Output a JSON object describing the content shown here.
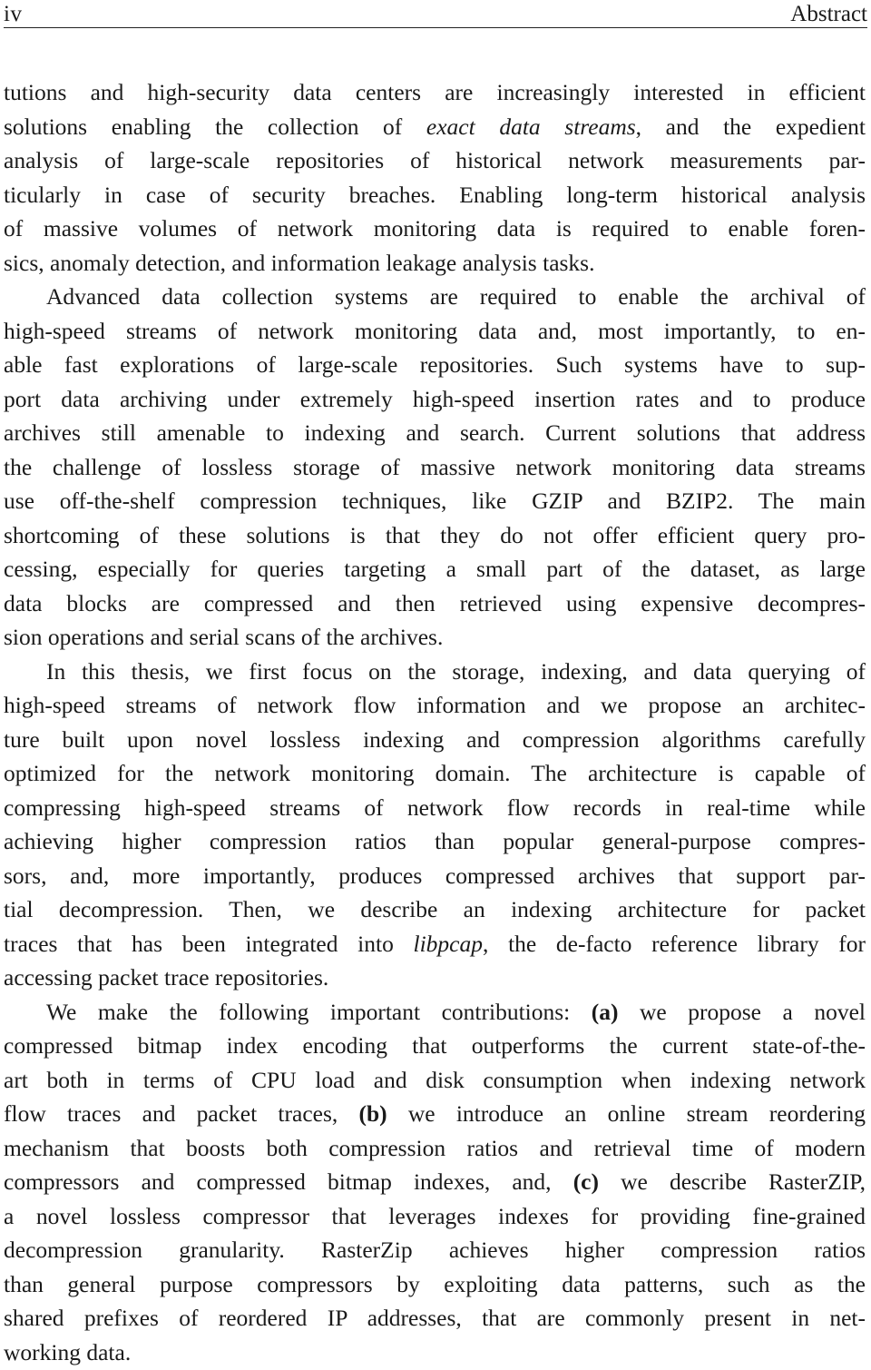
{
  "header": {
    "page_number": "iv",
    "section_title": "Abstract"
  },
  "paragraphs": [
    {
      "id": "p1",
      "indent": false,
      "lines": [
        [
          {
            "t": "tutions and high-security data centers are increasingly interested in efficient"
          }
        ],
        [
          {
            "t": "solutions enabling the collection of "
          },
          {
            "t": "exact data streams",
            "s": "i"
          },
          {
            "t": ", and the expedient"
          }
        ],
        [
          {
            "t": "analysis of large-scale repositories of historical network measurements par-"
          }
        ],
        [
          {
            "t": "ticularly in case of security breaches. Enabling long-term historical analysis"
          }
        ],
        [
          {
            "t": "of massive volumes of network monitoring data is required to enable foren-"
          }
        ],
        [
          {
            "t": "sics, anomaly detection, and information leakage analysis tasks."
          }
        ]
      ]
    },
    {
      "id": "p2",
      "indent": true,
      "lines": [
        [
          {
            "t": "Advanced data collection systems are required to enable the archival of"
          }
        ],
        [
          {
            "t": "high-speed streams of network monitoring data and, most importantly, to en-"
          }
        ],
        [
          {
            "t": "able fast explorations of large-scale repositories. Such systems have to sup-"
          }
        ],
        [
          {
            "t": "port data archiving under extremely high-speed insertion rates and to produce"
          }
        ],
        [
          {
            "t": "archives still amenable to indexing and search. Current solutions that address"
          }
        ],
        [
          {
            "t": "the challenge of lossless storage of massive network monitoring data streams"
          }
        ],
        [
          {
            "t": "use off-the-shelf compression techniques, like GZIP and BZIP2. The main"
          }
        ],
        [
          {
            "t": "shortcoming of these solutions is that they do not offer efficient query pro-"
          }
        ],
        [
          {
            "t": "cessing, especially for queries targeting a small part of the dataset, as large"
          }
        ],
        [
          {
            "t": "data blocks are compressed and then retrieved using expensive decompres-"
          }
        ],
        [
          {
            "t": "sion operations and serial scans of the archives."
          }
        ]
      ]
    },
    {
      "id": "p3",
      "indent": true,
      "lines": [
        [
          {
            "t": "In this thesis, we first focus on the storage, indexing, and data querying of"
          }
        ],
        [
          {
            "t": "high-speed streams of network flow information and we propose an architec-"
          }
        ],
        [
          {
            "t": "ture built upon novel lossless indexing and compression algorithms carefully"
          }
        ],
        [
          {
            "t": "optimized for the network monitoring domain. The architecture is capable of"
          }
        ],
        [
          {
            "t": "compressing high-speed streams of network flow records in real-time while"
          }
        ],
        [
          {
            "t": "achieving higher compression ratios than popular general-purpose compres-"
          }
        ],
        [
          {
            "t": "sors, and, more importantly, produces compressed archives that support par-"
          }
        ],
        [
          {
            "t": "tial decompression. Then, we describe an indexing architecture for packet"
          }
        ],
        [
          {
            "t": "traces that has been integrated into "
          },
          {
            "t": "libpcap",
            "s": "i"
          },
          {
            "t": ", the de-facto reference library for"
          }
        ],
        [
          {
            "t": "accessing packet trace repositories."
          }
        ]
      ]
    },
    {
      "id": "p4",
      "indent": true,
      "lines": [
        [
          {
            "t": "We make the following important contributions: "
          },
          {
            "t": "(a)",
            "s": "b"
          },
          {
            "t": " we propose a novel"
          }
        ],
        [
          {
            "t": "compressed bitmap index encoding that outperforms the current state-of-the-"
          }
        ],
        [
          {
            "t": "art both in terms of CPU load and disk consumption when indexing network"
          }
        ],
        [
          {
            "t": "flow traces and packet traces, "
          },
          {
            "t": "(b)",
            "s": "b"
          },
          {
            "t": " we introduce an online stream reordering"
          }
        ],
        [
          {
            "t": "mechanism that boosts both compression ratios and retrieval time of modern"
          }
        ],
        [
          {
            "t": "compressors and compressed bitmap indexes, and, "
          },
          {
            "t": "(c)",
            "s": "b"
          },
          {
            "t": " we describe RasterZIP,"
          }
        ],
        [
          {
            "t": "a novel lossless compressor that leverages indexes for providing fine-grained"
          }
        ],
        [
          {
            "t": "decompression granularity. RasterZip  achieves higher compression ratios"
          }
        ],
        [
          {
            "t": "than general purpose compressors by exploiting data patterns, such as the"
          }
        ],
        [
          {
            "t": "shared prefixes of reordered IP addresses, that are commonly present in net-"
          }
        ],
        [
          {
            "t": "working data."
          }
        ]
      ]
    }
  ]
}
